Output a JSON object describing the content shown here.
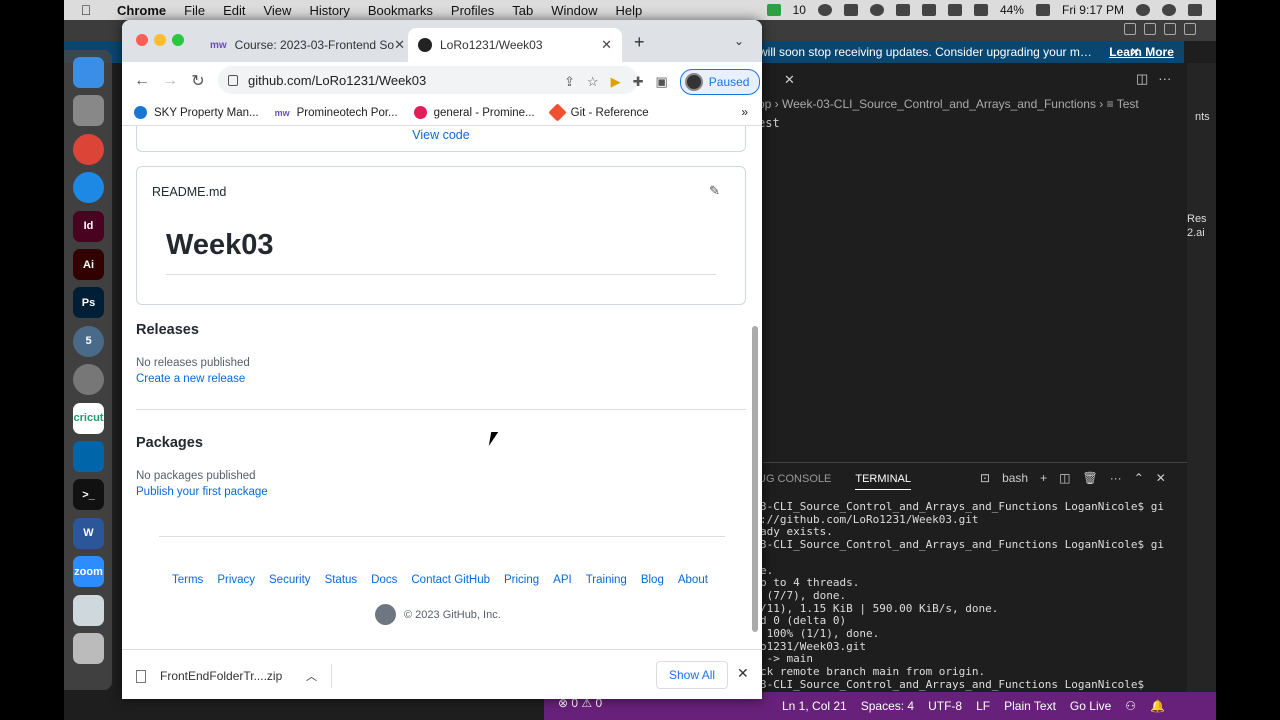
{
  "menubar": {
    "apple": "",
    "app": "Chrome",
    "items": [
      "File",
      "Edit",
      "View",
      "History",
      "Bookmarks",
      "Profiles",
      "Tab",
      "Window",
      "Help"
    ],
    "status": {
      "badge": "10",
      "battery": "44%",
      "clock": "Fri 9:17 PM"
    }
  },
  "vscode": {
    "title": "Test",
    "notification": "will soon stop receiving updates. Consider upgrading your m…",
    "learn_more": "Learn More",
    "breadcrumb": "op  ›  Week-03-CLI_Source_Control_and_Arrays_and_Functions  ›  ≡ Test",
    "editor_text": "est",
    "side_text_1": "nts",
    "side_text_2": "Res",
    "side_text_3": "2.ai",
    "panel_tabs": [
      "UG CONSOLE",
      "TERMINAL"
    ],
    "shell": "bash",
    "terminal_lines": [
      "3-CLI_Source_Control_and_Arrays_and_Functions LoganNicole$ gi",
      "://github.com/LoRo1231/Week03.git",
      "ady exists.",
      "3-CLI_Source_Control_and_Arrays_and_Functions LoganNicole$ gi",
      "",
      "e.",
      "p to 4 threads.",
      " (7/7), done.",
      "/11), 1.15 KiB | 590.00 KiB/s, done.",
      "d 0 (delta 0)",
      " 100% (1/1), done.",
      "o1231/Week03.git",
      " -> main",
      "ck remote branch main from origin.",
      "3-CLI_Source_Control_and_Arrays_and_Functions LoganNicole$ "
    ],
    "status_left": "⊗ 0 ⚠ 0",
    "status_items": [
      "Ln 1, Col 21",
      "Spaces: 4",
      "UTF-8",
      "LF",
      "Plain Text",
      "Go Live"
    ]
  },
  "chrome": {
    "tabs": [
      {
        "label": "Course: 2023-03-Frontend So",
        "favicon": "mw"
      },
      {
        "label": "LoRo1231/Week03",
        "favicon": "github-icon"
      }
    ],
    "url": "github.com/LoRo1231/Week03",
    "profile_label": "Paused",
    "bookmarks": [
      {
        "label": "SKY Property Man...",
        "color": "#1976d2"
      },
      {
        "label": "Promineotech Por...",
        "favicon": "mw",
        "color": "#6a4fb3"
      },
      {
        "label": "general - Promine...",
        "color": "#e01e5a"
      },
      {
        "label": "Git - Reference",
        "color": "#f05133"
      }
    ],
    "bookmarks_more": "»"
  },
  "page": {
    "view_code": "View code",
    "readme_filename": "README.md",
    "readme_heading": "Week03",
    "releases": {
      "title": "Releases",
      "text": "No releases published",
      "link": "Create a new release"
    },
    "packages": {
      "title": "Packages",
      "text": "No packages published",
      "link": "Publish your first package"
    },
    "footer_links": [
      "Terms",
      "Privacy",
      "Security",
      "Status",
      "Docs",
      "Contact GitHub",
      "Pricing",
      "API",
      "Training",
      "Blog",
      "About"
    ],
    "copyright": "© 2023 GitHub, Inc."
  },
  "downloads": {
    "file": "FrontEndFolderTr....zip",
    "show_all": "Show All"
  },
  "dock": [
    {
      "name": "finder",
      "label": "",
      "color": "#3a8ee6"
    },
    {
      "name": "launchpad",
      "label": "",
      "color": "#888"
    },
    {
      "name": "chrome",
      "label": "",
      "color": "#db4437"
    },
    {
      "name": "safari",
      "label": "",
      "color": "#1e88e5"
    },
    {
      "name": "indesign",
      "label": "Id",
      "color": "#49021f"
    },
    {
      "name": "illustrator",
      "label": "Ai",
      "color": "#330000"
    },
    {
      "name": "photoshop",
      "label": "Ps",
      "color": "#001e36"
    },
    {
      "name": "app-5",
      "label": "5",
      "color": "#4a6a8a"
    },
    {
      "name": "system-preferences",
      "label": "",
      "color": "#777"
    },
    {
      "name": "cricut",
      "label": "cricut",
      "color": "#ffffff"
    },
    {
      "name": "vscode",
      "label": "",
      "color": "#0065a9"
    },
    {
      "name": "terminal",
      "label": ">_",
      "color": "#111"
    },
    {
      "name": "word",
      "label": "W",
      "color": "#2b579a"
    },
    {
      "name": "zoom",
      "label": "zoom",
      "color": "#2d8cff"
    },
    {
      "name": "preview",
      "label": "",
      "color": "#cfd8dc"
    },
    {
      "name": "trash",
      "label": "",
      "color": "#bbb"
    }
  ]
}
